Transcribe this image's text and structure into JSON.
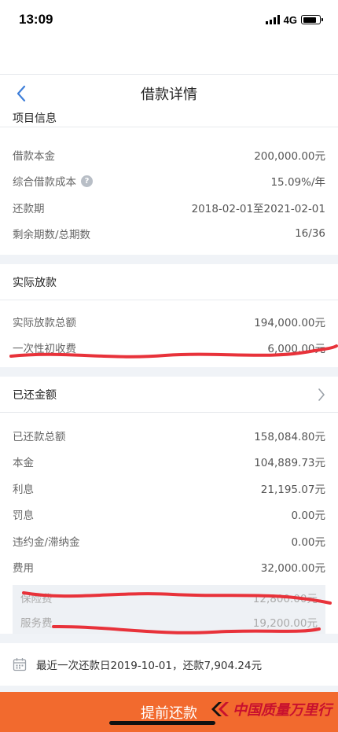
{
  "status_bar": {
    "time": "13:09",
    "network": "4G"
  },
  "navbar": {
    "title": "借款详情"
  },
  "project_info": {
    "header": "项目信息",
    "rows": [
      {
        "label": "借款本金",
        "value": "200,000.00元"
      },
      {
        "label": "综合借款成本",
        "value": "15.09%/年"
      },
      {
        "label": "还款期",
        "value": "2018-02-01至2021-02-01"
      },
      {
        "label": "剩余期数/总期数",
        "value": "16/36"
      }
    ]
  },
  "disbursement": {
    "header": "实际放款",
    "rows": [
      {
        "label": "实际放款总额",
        "value": "194,000.00元"
      },
      {
        "label": "一次性初收费",
        "value": "6,000.00元"
      }
    ]
  },
  "repaid": {
    "header": "已还金额",
    "rows": [
      {
        "label": "已还款总额",
        "value": "158,084.80元"
      },
      {
        "label": "本金",
        "value": "104,889.73元"
      },
      {
        "label": "利息",
        "value": "21,195.07元"
      },
      {
        "label": "罚息",
        "value": "0.00元"
      },
      {
        "label": "违约金/滞纳金",
        "value": "0.00元"
      },
      {
        "label": "费用",
        "value": "32,000.00元"
      }
    ],
    "fee_breakdown": [
      {
        "label": "保险费",
        "value": "12,800.00元"
      },
      {
        "label": "服务费",
        "value": "19,200.00元"
      }
    ]
  },
  "last_repayment": {
    "text": "最近一次还款日2019-10-01，还款7,904.24元"
  },
  "bottom_button": {
    "label": "提前还款"
  },
  "watermark": {
    "text": "中国质量万里行"
  },
  "colors": {
    "accent": "#f26a2e",
    "scribble": "#e8323a",
    "brand": "#c8102e"
  }
}
